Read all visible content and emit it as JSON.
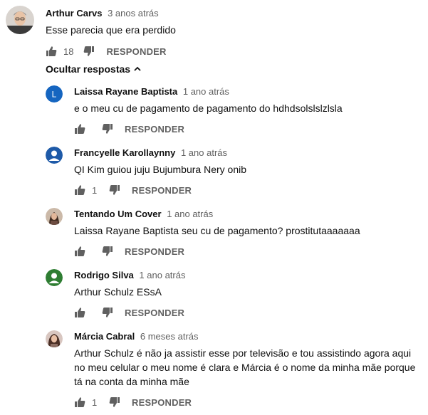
{
  "top_comment": {
    "author": "Arthur Carvs",
    "time": "3 anos atrás",
    "text": "Esse parecia que era perdido",
    "likes": "18",
    "reply_label": "RESPONDER",
    "avatar_icon": "person-photo-avatar"
  },
  "replies_toggle": {
    "label": "Ocultar respostas",
    "icon": "chevron-up-icon"
  },
  "replies": [
    {
      "author": "Laissa Rayane Baptista",
      "time": "1 ano atrás",
      "text": "e o meu cu de pagamento de pagamento do hdhdsolslslzlsla",
      "likes": "",
      "reply_label": "RESPONDER",
      "avatar_letter": "L",
      "avatar_color": "#1565c0"
    },
    {
      "author": "Francyelle Karollaynny",
      "time": "1 ano atrás",
      "text": "QI Kim guiou juju Bujumbura Nery onib",
      "likes": "1",
      "reply_label": "RESPONDER",
      "avatar_color": "#1e5aa8"
    },
    {
      "author": "Tentando Um Cover",
      "time": "1 ano atrás",
      "text": "Laissa Rayane Baptista   seu cu de pagamento?  prostitutaaaaaaa",
      "likes": "",
      "reply_label": "RESPONDER",
      "avatar_color": "#6d4c41"
    },
    {
      "author": "Rodrigo Silva",
      "time": "1 ano atrás",
      "text": "Arthur Schulz ESsA",
      "likes": "",
      "reply_label": "RESPONDER",
      "avatar_color": "#2e7d32"
    },
    {
      "author": "Márcia Cabral",
      "time": "6 meses atrás",
      "text": "Arthur Schulz é não ja assistir esse por televisão e tou assistindo agora aqui no meu celular o meu nome é clara e Márcia é o nome da minha mãe porque tá na conta da minha mãe",
      "likes": "1",
      "reply_label": "RESPONDER",
      "avatar_color": "#5d4037"
    }
  ]
}
